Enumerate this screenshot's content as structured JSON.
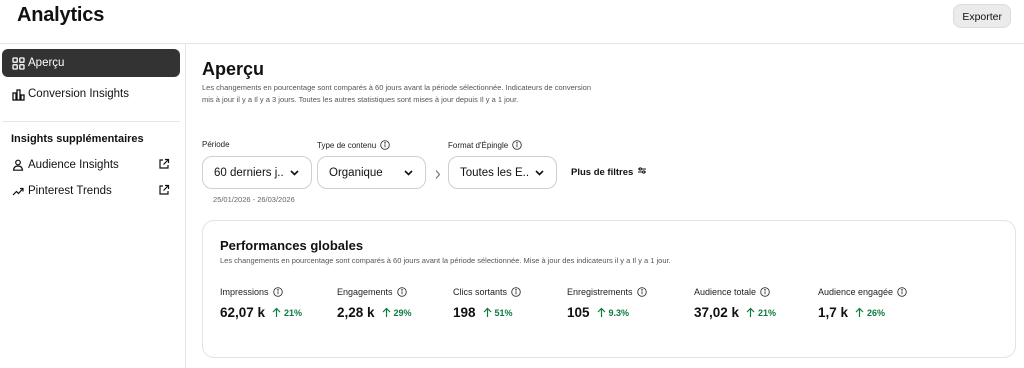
{
  "header": {
    "title": "Analytics",
    "export_label": "Exporter"
  },
  "sidebar": {
    "items": [
      {
        "label": "Aperçu",
        "icon": "grid-icon",
        "active": true
      },
      {
        "label": "Conversion Insights",
        "icon": "bar-chart-icon",
        "active": false
      }
    ],
    "section_heading": "Insights supplémentaires",
    "extra_items": [
      {
        "label": "Audience Insights",
        "icon": "person-icon",
        "external_icon": "external-link-icon"
      },
      {
        "label": "Pinterest Trends",
        "icon": "trend-icon",
        "external_icon": "external-link-icon"
      }
    ]
  },
  "main": {
    "title": "Aperçu",
    "description": "Les changements en pourcentage sont comparés à 60 jours avant la période sélectionnée. Indicateurs de conversion mis à jour il y a Il y a 3 jours. Toutes les autres statistiques sont mises à jour depuis Il y a 1 jour.",
    "filters": {
      "period": {
        "label": "Période",
        "value": "60 derniers j..."
      },
      "content_type": {
        "label": "Type de contenu",
        "value": "Organique"
      },
      "pin_format": {
        "label": "Format d'Épingle",
        "value": "Toutes les É..."
      },
      "more_filters_label": "Plus de filtres",
      "date_range": "25/01/2026 - 26/03/2026"
    },
    "performance": {
      "title": "Performances globales",
      "description": "Les changements en pourcentage sont comparés à 60 jours avant la période sélectionnée. Mise à jour des indicateurs il y a Il y a 1 jour.",
      "metrics": [
        {
          "label": "Impressions",
          "value": "62,07 k",
          "delta": "21%"
        },
        {
          "label": "Engagements",
          "value": "2,28 k",
          "delta": "29%"
        },
        {
          "label": "Clics sortants",
          "value": "198",
          "delta": "51%"
        },
        {
          "label": "Enregistrements",
          "value": "105",
          "delta": "9.3%"
        },
        {
          "label": "Audience totale",
          "value": "37,02 k",
          "delta": "21%"
        },
        {
          "label": "Audience engagée",
          "value": "1,7 k",
          "delta": "26%"
        }
      ]
    }
  },
  "colors": {
    "active_nav_bg": "#333333",
    "positive_delta": "#0d7a3e",
    "border": "#e3e3e3"
  }
}
